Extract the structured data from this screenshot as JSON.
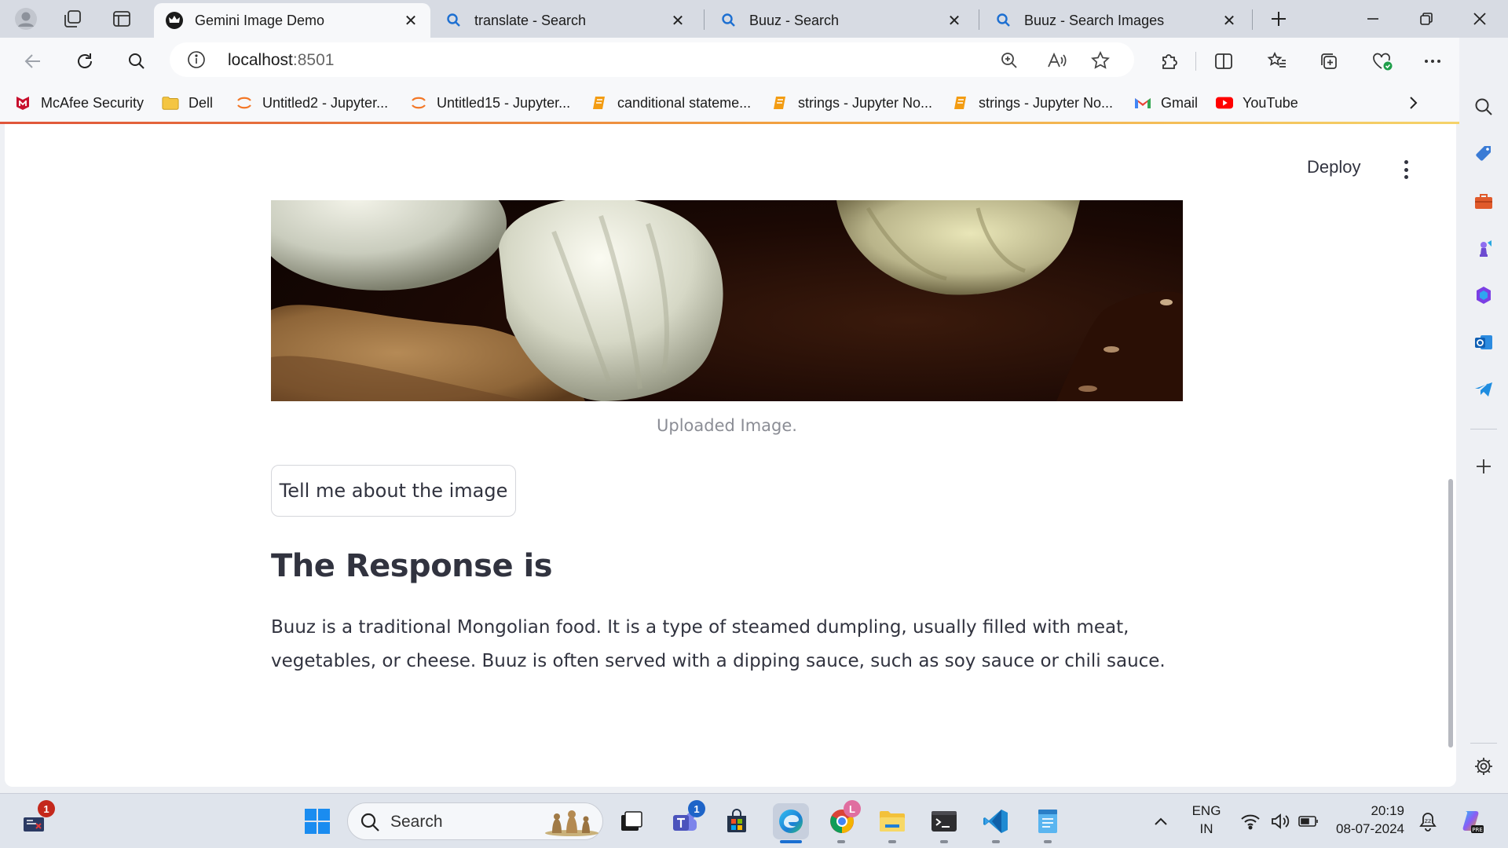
{
  "browser": {
    "tabs": [
      {
        "title": "Gemini Image Demo",
        "active": true,
        "icon": "crown-icon"
      },
      {
        "title": "translate - Search",
        "active": false,
        "icon": "search-icon"
      },
      {
        "title": "Buuz - Search",
        "active": false,
        "icon": "search-icon"
      },
      {
        "title": "Buuz - Search Images",
        "active": false,
        "icon": "search-icon"
      }
    ],
    "address": {
      "host": "localhost",
      "port": ":8501"
    },
    "bookmarks": [
      {
        "label": "McAfee Security",
        "icon": "mcafee-icon"
      },
      {
        "label": "Dell",
        "icon": "folder-icon"
      },
      {
        "label": "Untitled2 - Jupyter...",
        "icon": "jupyter-icon"
      },
      {
        "label": "Untitled15 - Jupyter...",
        "icon": "jupyter-icon"
      },
      {
        "label": "canditional stateme...",
        "icon": "notebook-icon"
      },
      {
        "label": "strings - Jupyter No...",
        "icon": "notebook-icon"
      },
      {
        "label": "strings - Jupyter No...",
        "icon": "notebook-icon"
      },
      {
        "label": "Gmail",
        "icon": "gmail-icon"
      },
      {
        "label": "YouTube",
        "icon": "youtube-icon"
      }
    ]
  },
  "app": {
    "deploy_label": "Deploy",
    "image_caption": "Uploaded Image.",
    "button_label": "Tell me about the image",
    "response_heading": "The Response is",
    "response_text": "Buuz is a traditional Mongolian food. It is a type of steamed dumpling, usually filled with meat, vegetables, or cheese. Buuz is often served with a dipping sauce, such as soy sauce or chili sauce."
  },
  "taskbar": {
    "search_placeholder": "Search",
    "notification_badge": "1",
    "teams_badge": "1",
    "chrome_profile": "L",
    "language": {
      "line1": "ENG",
      "line2": "IN"
    },
    "time": "20:19",
    "date": "08-07-2024"
  },
  "colors": {
    "accent_gradient": [
      "#e0553a",
      "#f2a341",
      "#f5d36a"
    ],
    "text_primary": "#31333f",
    "caption": "#8b8d95"
  }
}
